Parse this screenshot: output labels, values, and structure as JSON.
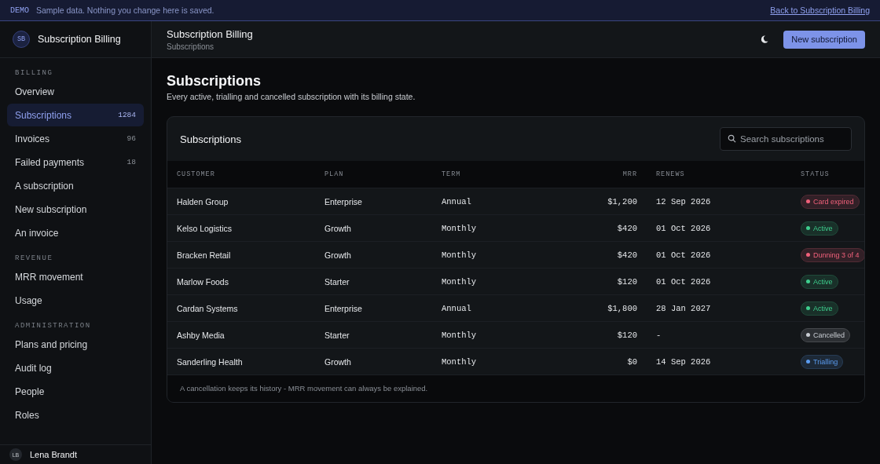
{
  "banner": {
    "tag": "DEMO",
    "message": "Sample data. Nothing you change here is saved.",
    "link": "Back to Subscription Billing"
  },
  "sidebar": {
    "logo": "SB",
    "app_name": "Subscription Billing",
    "sections": [
      {
        "heading": "BILLING",
        "items": [
          {
            "label": "Overview",
            "selected": false
          },
          {
            "label": "Subscriptions",
            "count": "1284",
            "selected": true
          },
          {
            "label": "Invoices",
            "count": "96",
            "selected": false
          },
          {
            "label": "Failed payments",
            "count": "18",
            "selected": false
          },
          {
            "label": "A subscription",
            "selected": false
          },
          {
            "label": "New subscription",
            "selected": false
          },
          {
            "label": "An invoice",
            "selected": false
          }
        ]
      },
      {
        "heading": "REVENUE",
        "items": [
          {
            "label": "MRR movement",
            "selected": false
          },
          {
            "label": "Usage",
            "selected": false
          }
        ]
      },
      {
        "heading": "ADMINISTRATION",
        "items": [
          {
            "label": "Plans and pricing",
            "selected": false
          },
          {
            "label": "Audit log",
            "selected": false
          },
          {
            "label": "People",
            "selected": false
          },
          {
            "label": "Roles",
            "selected": false
          }
        ]
      }
    ],
    "user": {
      "initials": "LB",
      "name": "Lena Brandt"
    }
  },
  "header": {
    "title": "Subscription Billing",
    "breadcrumb": "Subscriptions",
    "primary_button": "New subscription"
  },
  "page": {
    "title": "Subscriptions",
    "subtitle": "Every active, trialling and cancelled subscription with its billing state."
  },
  "card": {
    "title": "Subscriptions",
    "search": {
      "placeholder": "Search subscriptions"
    },
    "table": {
      "columns": [
        "CUSTOMER",
        "PLAN",
        "TERM",
        "MRR",
        "RENEWS",
        "STATUS"
      ],
      "rows": [
        {
          "customer": "Halden Group",
          "plan": "Enterprise",
          "term": "Annual",
          "mrr": "$1,200",
          "renews": "12 Sep 2026",
          "status": {
            "label": "Card expired",
            "color": "#f0607a"
          }
        },
        {
          "customer": "Kelso Logistics",
          "plan": "Growth",
          "term": "Monthly",
          "mrr": "$420",
          "renews": "01 Oct 2026",
          "status": {
            "label": "Active",
            "color": "#3ecf8e"
          }
        },
        {
          "customer": "Bracken Retail",
          "plan": "Growth",
          "term": "Monthly",
          "mrr": "$420",
          "renews": "01 Oct 2026",
          "status": {
            "label": "Dunning 3 of 4",
            "color": "#f0607a"
          }
        },
        {
          "customer": "Marlow Foods",
          "plan": "Starter",
          "term": "Monthly",
          "mrr": "$120",
          "renews": "01 Oct 2026",
          "status": {
            "label": "Active",
            "color": "#3ecf8e"
          }
        },
        {
          "customer": "Cardan Systems",
          "plan": "Enterprise",
          "term": "Annual",
          "mrr": "$1,800",
          "renews": "28 Jan 2027",
          "status": {
            "label": "Active",
            "color": "#3ecf8e"
          }
        },
        {
          "customer": "Ashby Media",
          "plan": "Starter",
          "term": "Monthly",
          "mrr": "$120",
          "renews": "-",
          "status": {
            "label": "Cancelled",
            "color": "#c8ccd2"
          }
        },
        {
          "customer": "Sanderling Health",
          "plan": "Growth",
          "term": "Monthly",
          "mrr": "$0",
          "renews": "14 Sep 2026",
          "status": {
            "label": "Trialling",
            "color": "#5b9cf0"
          }
        }
      ]
    },
    "footnote": "A cancellation keeps its history - MRR movement can always be explained."
  }
}
